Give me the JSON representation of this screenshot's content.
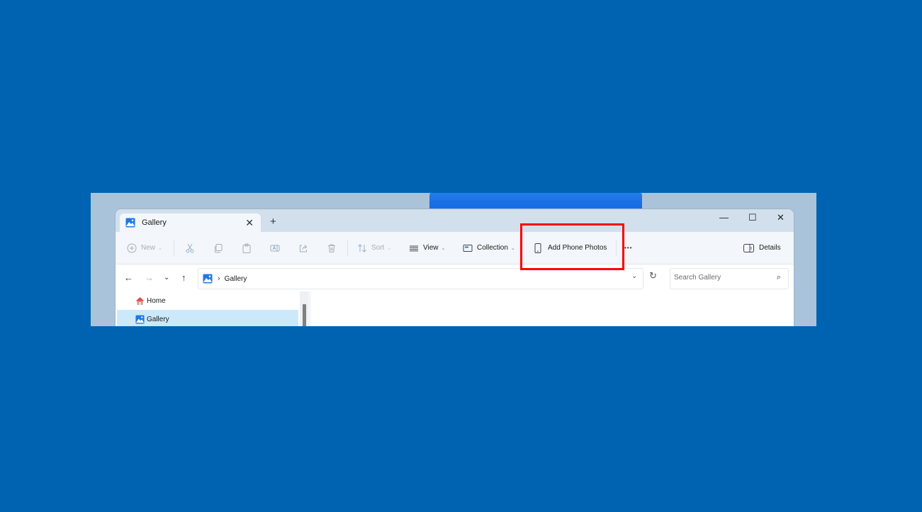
{
  "window": {
    "tab": {
      "label": "Gallery",
      "icon": "gallery-icon"
    },
    "new_tab_glyph": "+",
    "close_glyph": "✕",
    "controls": {
      "minimize": "—",
      "maximize": "☐",
      "close": "✕"
    }
  },
  "toolbar": {
    "new_label": "New",
    "sort_label": "Sort",
    "view_label": "View",
    "collection_label": "Collection",
    "add_phone_photos_label": "Add Phone Photos",
    "more_glyph": "•••",
    "details_label": "Details",
    "caret": "⌄"
  },
  "navigation": {
    "back": "←",
    "forward": "→",
    "recent": "⌄",
    "up": "↑",
    "breadcrumb": {
      "separator": "›",
      "location": "Gallery"
    },
    "dropdown": "⌄",
    "refresh": "↻",
    "search_placeholder": "Search Gallery",
    "search_icon": "⌕"
  },
  "sidebar": {
    "items": [
      {
        "label": "Home",
        "icon": "home-icon",
        "selected": false
      },
      {
        "label": "Gallery",
        "icon": "gallery-icon",
        "selected": true
      }
    ]
  },
  "annotation": {
    "highlight_color": "#ff0000",
    "target": "Add Phone Photos"
  },
  "colors": {
    "background": "#0063B1",
    "accent": "#0067c0",
    "selection": "#cce8fb"
  }
}
